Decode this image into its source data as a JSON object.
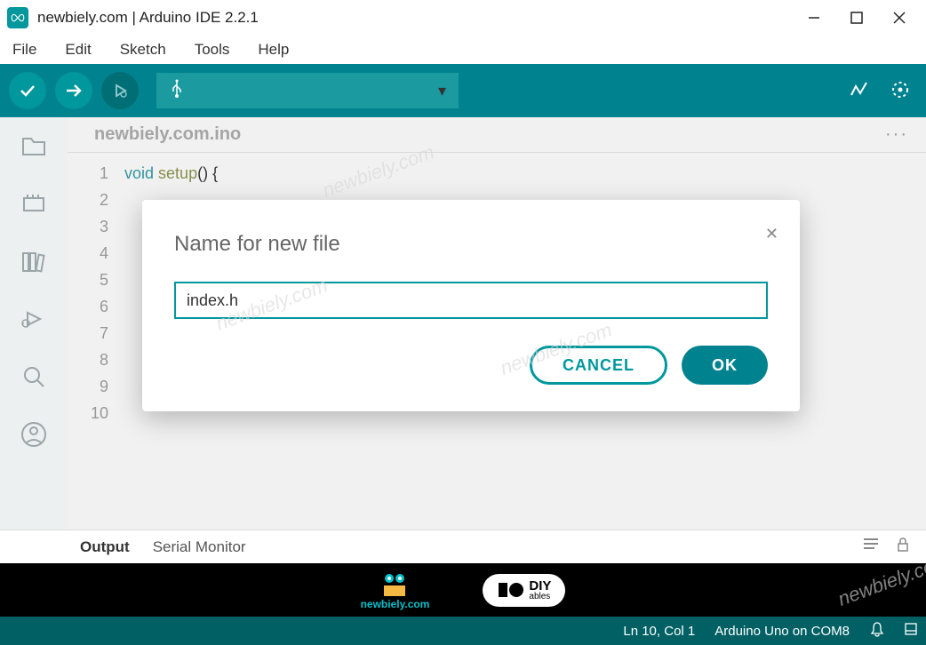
{
  "window": {
    "title": "newbiely.com | Arduino IDE 2.2.1"
  },
  "menu": {
    "file": "File",
    "edit": "Edit",
    "sketch": "Sketch",
    "tools": "Tools",
    "help": "Help"
  },
  "toolbar": {
    "board_selector_icon": "usb",
    "board_selector_dropdown": "▾"
  },
  "tabs": {
    "active": "newbiely.com.ino",
    "more": "···"
  },
  "code": {
    "line_numbers": [
      "1",
      "2",
      "3",
      "4",
      "5",
      "6",
      "7",
      "8",
      "9",
      "10"
    ],
    "line1_kw": "void",
    "line1_fn": "setup",
    "line1_rest": "() {"
  },
  "output_tabs": {
    "output": "Output",
    "serial": "Serial Monitor"
  },
  "logos": {
    "newbiely": "newbiely.com",
    "diy_top": "DIY",
    "diy_bottom": "ables"
  },
  "statusbar": {
    "position": "Ln 10, Col 1",
    "board": "Arduino Uno on COM8"
  },
  "modal": {
    "title": "Name for new file",
    "input_value": "index.h",
    "cancel": "CANCEL",
    "ok": "OK"
  },
  "watermark": "newbiely.com"
}
